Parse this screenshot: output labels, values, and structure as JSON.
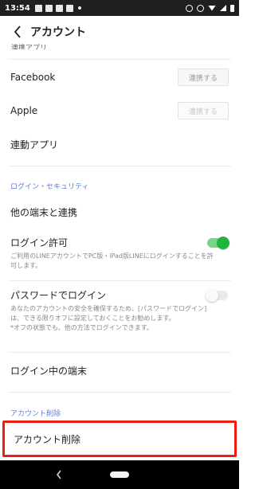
{
  "status_bar": {
    "time": "13:54"
  },
  "header": {
    "title": "アカウント"
  },
  "partial_text": "連携アプリ",
  "rows": {
    "facebook": {
      "label": "Facebook",
      "button": "連携する"
    },
    "apple": {
      "label": "Apple",
      "button": "連携する"
    },
    "linked_apps": {
      "label": "連動アプリ"
    }
  },
  "login_security": {
    "header": "ログイン・セキュリティ",
    "other_devices": "他の端末と連携",
    "login_permission": {
      "title": "ログイン許可",
      "desc": "ご利用のLINEアカウントでPC版・iPad版LINEにログインすることを許可します。",
      "enabled": true
    },
    "password_login": {
      "title": "パスワードでログイン",
      "desc": "あなたのアカウントの安全を確保するため、[パスワードでログイン]は、できる限りオフに設定しておくことをお勧めします。",
      "note": "*オフの状態でも、他の方法でログインできます。",
      "enabled": false
    },
    "logged_in_devices": "ログイン中の端末"
  },
  "delete_section": {
    "header": "アカウント削除",
    "item": "アカウント削除"
  },
  "colors": {
    "accent_blue": "#5e7fd6",
    "toggle_green": "#1fb53f",
    "highlight_red": "#ee1d11"
  }
}
